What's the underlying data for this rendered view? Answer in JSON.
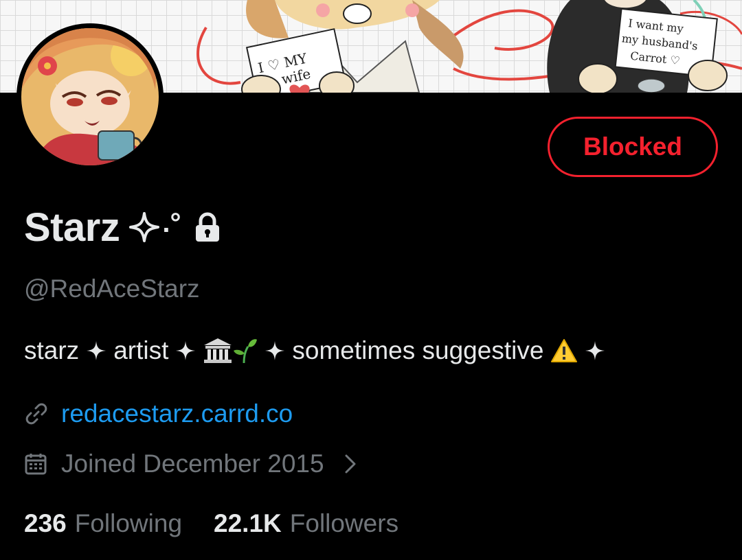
{
  "banner": {
    "sign_left_line1": "I ♡ MY",
    "sign_left_line2": "wife",
    "sign_right_line1": "I want my",
    "sign_right_line2": "my husband's",
    "sign_right_line3": "Carrot ♡"
  },
  "profile": {
    "display_name": "Starz",
    "name_decoration": ".°",
    "handle": "@RedAceStarz",
    "bio": {
      "word1": "starz",
      "word2": "artist",
      "word3": "sometimes suggestive",
      "warning_emoji": "⚠️"
    },
    "website": "redacestarz.carrd.co",
    "joined": "Joined December 2015"
  },
  "actions": {
    "blocked_label": "Blocked"
  },
  "stats": {
    "following_count": "236",
    "following_label": "Following",
    "followers_count": "22.1K",
    "followers_label": "Followers"
  },
  "colors": {
    "background": "#000000",
    "primary_text": "#e7e9ea",
    "secondary_text": "#71767b",
    "link": "#1d9bf0",
    "blocked": "#f4212e"
  },
  "icons": [
    "lock-icon",
    "sparkle-icon",
    "classical-building-icon",
    "seedling-icon",
    "warning-icon",
    "link-icon",
    "calendar-icon",
    "chevron-right-icon"
  ]
}
